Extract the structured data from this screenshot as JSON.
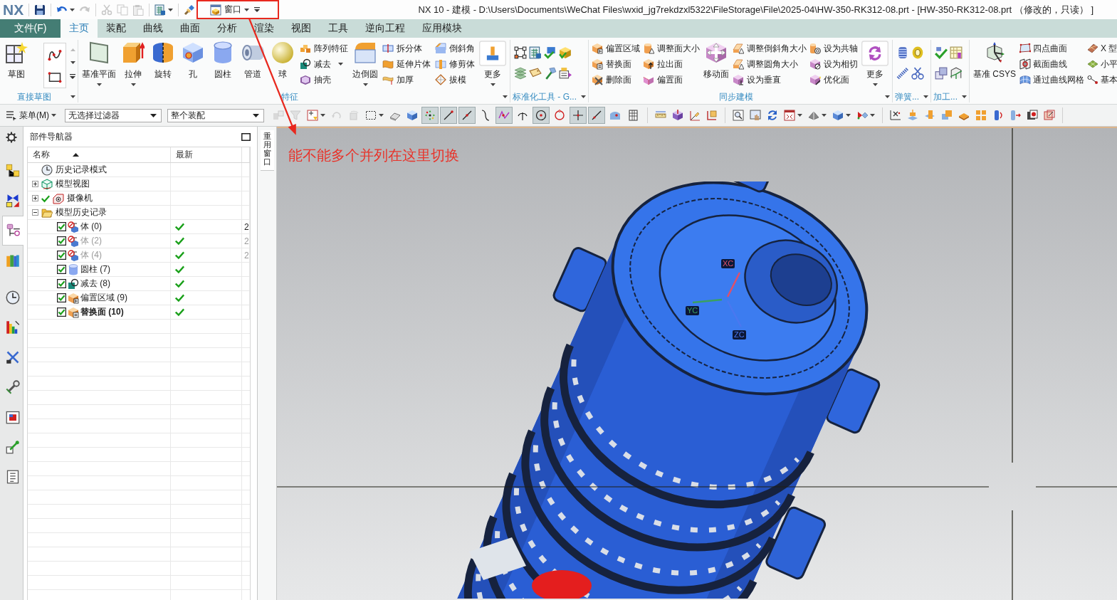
{
  "title_bar": {
    "logo": "NX",
    "quick_access": [
      {
        "disabled": false,
        "dropdown": false
      },
      {
        "disabled": false,
        "dropdown": true
      },
      {
        "disabled": true,
        "dropdown": false
      },
      {
        "disabled": true,
        "dropdown": false
      },
      {
        "disabled": true,
        "dropdown": false
      },
      {
        "disabled": true,
        "dropdown": false
      },
      {
        "disabled": false,
        "dropdown": true
      },
      {
        "disabled": false,
        "dropdown": false
      }
    ],
    "window_menu": {
      "label": "窗口"
    },
    "title": "NX 10 - 建模 - D:\\Users\\Documents\\WeChat Files\\wxid_jg7rekdzxl5322\\FileStorage\\File\\2025-04\\HW-350-RK312-08.prt - [HW-350-RK312-08.prt （修改的，只读） ]"
  },
  "ribbon_tabs": [
    {
      "label": "文件(F)",
      "kind": "file",
      "selected": false
    },
    {
      "label": "主页",
      "kind": "tab",
      "selected": true
    },
    {
      "label": "装配",
      "kind": "tab",
      "selected": false
    },
    {
      "label": "曲线",
      "kind": "tab",
      "selected": false
    },
    {
      "label": "曲面",
      "kind": "tab",
      "selected": false
    },
    {
      "label": "分析",
      "kind": "tab",
      "selected": false
    },
    {
      "label": "渲染",
      "kind": "tab",
      "selected": false
    },
    {
      "label": "视图",
      "kind": "tab",
      "selected": false
    },
    {
      "label": "工具",
      "kind": "tab",
      "selected": false
    },
    {
      "label": "逆向工程",
      "kind": "tab",
      "selected": false
    },
    {
      "label": "应用模块",
      "kind": "tab",
      "selected": false
    }
  ],
  "ribbon_groups": [
    {
      "label": "直接草图",
      "menu": true,
      "columns": [
        {
          "kind": "large",
          "label": "草图",
          "dropdown": false
        },
        {
          "kind": "gallery"
        }
      ]
    },
    {
      "label": "特征",
      "menu": true,
      "columns": [
        {
          "kind": "large",
          "label": "基准平面",
          "dropdown": true
        },
        {
          "kind": "large",
          "label": "拉伸",
          "dropdown": true
        },
        {
          "kind": "large",
          "label": "旋转",
          "dropdown": false
        },
        {
          "kind": "large",
          "label": "孔",
          "dropdown": false
        },
        {
          "kind": "large",
          "label": "圆柱",
          "dropdown": false
        },
        {
          "kind": "large",
          "label": "管道",
          "dropdown": false
        },
        {
          "kind": "large",
          "label": "球",
          "dropdown": false
        },
        {
          "kind": "stack",
          "items": [
            {
              "label": "阵列特征",
              "dropdown": false
            },
            {
              "label": "减去",
              "dropdown": true
            },
            {
              "label": "抽壳",
              "dropdown": false
            }
          ]
        },
        {
          "kind": "large",
          "label": "边倒圆",
          "dropdown": true
        },
        {
          "kind": "stack",
          "items": [
            {
              "label": "拆分体",
              "dropdown": false
            },
            {
              "label": "延伸片体",
              "dropdown": false
            },
            {
              "label": "加厚",
              "dropdown": false
            }
          ]
        },
        {
          "kind": "stack",
          "items": [
            {
              "label": "倒斜角",
              "dropdown": false
            },
            {
              "label": "修剪体",
              "dropdown": false
            },
            {
              "label": "拔模",
              "dropdown": false
            }
          ]
        },
        {
          "kind": "more",
          "label": "更多",
          "dropdown": true
        }
      ]
    },
    {
      "label": "标准化工具 - G...",
      "menu": true,
      "columns": [
        {
          "kind": "icon_grid"
        }
      ]
    },
    {
      "label": "同步建模",
      "menu": true,
      "columns": [
        {
          "kind": "stack",
          "items": [
            {
              "label": "偏置区域",
              "dropdown": false
            },
            {
              "label": "替换面",
              "dropdown": false
            },
            {
              "label": "删除面",
              "dropdown": false
            }
          ]
        },
        {
          "kind": "stack",
          "items": [
            {
              "label": "调整面大小",
              "dropdown": false
            },
            {
              "label": "拉出面",
              "dropdown": false
            },
            {
              "label": "偏置面",
              "dropdown": false
            }
          ]
        },
        {
          "kind": "large",
          "label": "移动面",
          "dropdown": false
        },
        {
          "kind": "stack",
          "items": [
            {
              "label": "调整倒斜角大小",
              "dropdown": false
            },
            {
              "label": "调整圆角大小",
              "dropdown": false
            },
            {
              "label": "设为垂直",
              "dropdown": false
            }
          ]
        },
        {
          "kind": "stack",
          "items": [
            {
              "label": "设为共轴",
              "dropdown": false
            },
            {
              "label": "设为相切",
              "dropdown": false
            },
            {
              "label": "优化面",
              "dropdown": false
            }
          ]
        },
        {
          "kind": "more",
          "label": "更多",
          "dropdown": true
        }
      ]
    },
    {
      "label": "弹簧...",
      "menu": true,
      "columns": [
        {
          "kind": "icon_grid"
        }
      ]
    },
    {
      "label": "加工...",
      "menu": true,
      "columns": [
        {
          "kind": "icon_grid"
        }
      ]
    },
    {
      "menu": false,
      "columns": [
        {
          "kind": "large",
          "label": "基准 CSYS",
          "dropdown": false
        },
        {
          "kind": "stack",
          "items": [
            {
              "label": "四点曲面",
              "dropdown": false
            },
            {
              "label": "截面曲线",
              "dropdown": false
            },
            {
              "label": "通过曲线网格",
              "dropdown": false
            }
          ]
        },
        {
          "kind": "stack",
          "items": [
            {
              "label": "X 型",
              "dropdown": false
            },
            {
              "label": "小平",
              "dropdown": false
            },
            {
              "label": "基本",
              "dropdown": false
            }
          ]
        }
      ]
    }
  ],
  "toolbar": {
    "menu": {
      "label": "菜单(M)"
    },
    "filters": [
      {
        "value": "无选择过滤器"
      },
      {
        "value": "整个装配"
      }
    ],
    "selection_tools": [
      {
        "disabled": true,
        "dropdown": false
      },
      {
        "disabled": true,
        "dropdown": false
      },
      {
        "disabled": false,
        "dropdown": true
      },
      {
        "disabled": true,
        "dropdown": false
      },
      {
        "disabled": true,
        "dropdown": false
      },
      {
        "disabled": false,
        "dropdown": true
      },
      {
        "disabled": false,
        "dropdown": false
      },
      {
        "disabled": false,
        "dropdown": false
      }
    ],
    "snap_tools": [
      {
        "on": true
      },
      {
        "on": true
      },
      {
        "on": true
      },
      {
        "on": false
      },
      {
        "on": true
      },
      {
        "on": false
      },
      {
        "on": true
      },
      {
        "on": false
      },
      {
        "on": true
      },
      {
        "on": true
      },
      {
        "on": false
      },
      {
        "on": false
      }
    ],
    "view_tools": [
      {
        "dropdown": false
      },
      {
        "dropdown": false
      },
      {
        "dropdown": false
      },
      {
        "dropdown": true
      },
      {
        "dropdown": true
      },
      {
        "dropdown": true
      },
      {
        "dropdown": true
      }
    ]
  },
  "resource_bar": {
    "tabs": [
      {
        "selected": false
      },
      {
        "selected": false
      },
      {
        "selected": true
      },
      {
        "selected": false
      },
      {
        "selected": false
      },
      {
        "selected": false
      },
      {
        "selected": false
      },
      {
        "selected": false
      },
      {
        "selected": false
      },
      {
        "selected": false
      },
      {
        "selected": false
      }
    ]
  },
  "part_navigator": {
    "title": "部件导航器",
    "columns": [
      {
        "label": "名称",
        "sorted": true
      },
      {
        "label": "最新",
        "sorted": false
      }
    ],
    "nodes": [
      {
        "label": "历史记录模式",
        "kind": "history-mode",
        "ticked": false
      },
      {
        "label": "模型视图",
        "kind": "model-views",
        "ticked": false,
        "expanded": false
      },
      {
        "label": "摄像机",
        "kind": "cameras",
        "ticked": true,
        "expanded": false
      },
      {
        "label": "模型历史记录",
        "kind": "folder",
        "ticked": false,
        "expanded": true,
        "children": [
          {
            "label": "体 (0)",
            "kind": "body",
            "checked": true,
            "inactive": false,
            "current": false,
            "latest": true,
            "column_3": "2"
          },
          {
            "label": "体 (2)",
            "kind": "body",
            "checked": true,
            "inactive": true,
            "current": false,
            "latest": true,
            "column_3": "2"
          },
          {
            "label": "体 (4)",
            "kind": "body",
            "checked": true,
            "inactive": true,
            "current": false,
            "latest": true,
            "column_3": "2"
          },
          {
            "label": "圆柱 (7)",
            "kind": "cylinder",
            "checked": true,
            "inactive": false,
            "current": false,
            "latest": true
          },
          {
            "label": "减去 (8)",
            "kind": "subtract",
            "checked": true,
            "inactive": false,
            "current": false,
            "latest": true
          },
          {
            "label": "偏置区域 (9)",
            "kind": "offset-region",
            "checked": true,
            "inactive": false,
            "current": false,
            "latest": true
          },
          {
            "label": "替换面 (10)",
            "kind": "replace-face",
            "checked": true,
            "inactive": false,
            "current": true,
            "latest": true
          }
        ]
      }
    ]
  },
  "side_strip": {
    "tab": "重用窗口"
  },
  "viewport": {
    "axes": [
      {
        "label": "XC",
        "color": "#e0506a"
      },
      {
        "label": "YC",
        "color": "#3aa060"
      },
      {
        "label": "ZC",
        "color": "#4a78f0"
      }
    ]
  },
  "annotation": {
    "text": "能不能多个并列在这里切换"
  }
}
